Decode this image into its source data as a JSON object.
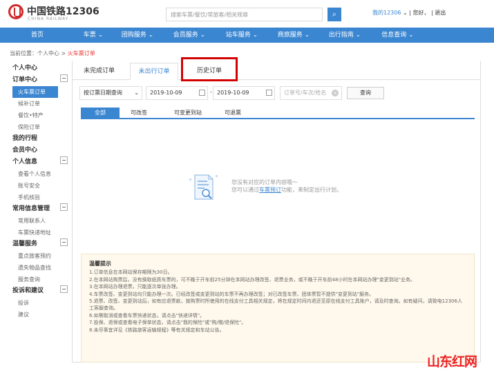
{
  "header": {
    "brand": "中国铁路12306",
    "brand_sub": "CHINA RAILWAY",
    "search_placeholder": "搜索车票/餐饮/常旅客/相关规章",
    "search_button": "⌕",
    "my_12306": "我的12306",
    "greeting": "您好，",
    "logout": "退出"
  },
  "nav": [
    "首页",
    "车票 ⌄",
    "团购服务 ⌄",
    "会员服务 ⌄",
    "站车服务 ⌄",
    "商旅服务 ⌄",
    "出行指南 ⌄",
    "信息查询 ⌄"
  ],
  "breadcrumb": {
    "prefix": "当前位置：个人中心 > ",
    "current": "火车票订单"
  },
  "sidebar": [
    {
      "type": "h",
      "label": "个人中心",
      "box": false
    },
    {
      "type": "h",
      "label": "订单中心",
      "box": true
    },
    {
      "type": "i",
      "label": "火车票订单",
      "active": true
    },
    {
      "type": "i",
      "label": "候补订单"
    },
    {
      "type": "i",
      "label": "餐饮•特产"
    },
    {
      "type": "i",
      "label": "保险订单"
    },
    {
      "type": "h",
      "label": "我的行程",
      "box": false
    },
    {
      "type": "h",
      "label": "会员中心",
      "box": false
    },
    {
      "type": "h",
      "label": "个人信息",
      "box": true
    },
    {
      "type": "i",
      "label": "查看个人信息"
    },
    {
      "type": "i",
      "label": "账号安全"
    },
    {
      "type": "i",
      "label": "手机核验"
    },
    {
      "type": "h",
      "label": "常用信息管理",
      "box": true
    },
    {
      "type": "i",
      "label": "常用联系人"
    },
    {
      "type": "i",
      "label": "车票快递地址"
    },
    {
      "type": "h",
      "label": "温馨服务",
      "box": true
    },
    {
      "type": "i",
      "label": "重点旅客预约"
    },
    {
      "type": "i",
      "label": "遗失物品查找"
    },
    {
      "type": "i",
      "label": "服务查询"
    },
    {
      "type": "h",
      "label": "投诉和建议",
      "box": true
    },
    {
      "type": "i",
      "label": "投诉"
    },
    {
      "type": "i",
      "label": "建议"
    }
  ],
  "tabs": [
    "未完成订单",
    "未出行订单",
    "历史订单"
  ],
  "filters": {
    "date_type": "按订票日期查询",
    "start_date": "2019-10-09",
    "end_date": "2019-10-09",
    "keyword_placeholder": "订单号/车次/姓名",
    "query": "查询"
  },
  "subtabs": [
    "全部",
    "可改签",
    "可变更到站",
    "可退票"
  ],
  "empty": {
    "line1": "您没有对应的订单内容哦～",
    "line2_pre": "您可以通过",
    "line2_link": "车票预订",
    "line2_post": "功能，来制定出行计划。"
  },
  "tips": {
    "title": "温馨提示",
    "items": [
      "1.订单信息在本网站保存期限为30日。",
      "2.在本网站购票后，没有换取纸质车票的，可不晚于开车前25分钟在本网站办理改签、退票业务，或不晚于开车前48小时在本网站办理\"变更到站\"业务。",
      "3.在本网站办理退票，只能逐次单张办理。",
      "4.车票改签、变更到站均只能办理一次。已经改签或变更到站的车票不再办理改签；对已改签车票、团体票暂不提供\"变更到站\"服务。",
      "5.退票、改签、变更到站后，如有应退票款，按购票时所使用的在线支付工具相关规定，将在规定时间内退还至原在线支付工具账户，请及时查询。如有疑问，请致电12306人工客服查询。",
      "6.如需取消或查看车票快递状态，请点击\"快递详情\"。",
      "7.投保、退保或查看电子保单状态，请点击\"我的保险\"或\"购/赠/退保险\"。",
      "8.未尽事宜详见《铁路旅客运输规程》等有关规定和车站公告。"
    ]
  },
  "watermark": "山东红网"
}
